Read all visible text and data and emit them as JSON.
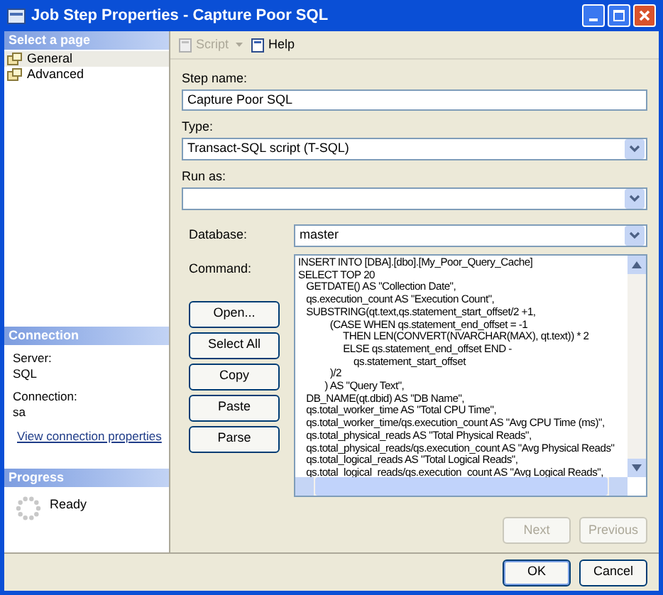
{
  "window": {
    "title": "Job Step Properties - Capture Poor SQL"
  },
  "select_page": {
    "header": "Select a page",
    "items": [
      {
        "label": "General",
        "selected": true
      },
      {
        "label": "Advanced",
        "selected": false
      }
    ]
  },
  "connection": {
    "header": "Connection",
    "server_label": "Server:",
    "server": "SQL",
    "connection_label": "Connection:",
    "connection": "sa",
    "link": "View connection properties"
  },
  "progress": {
    "header": "Progress",
    "status": "Ready"
  },
  "toolbar": [
    {
      "label": "Script",
      "disabled": true,
      "kind": "dropdown"
    },
    {
      "label": "Help",
      "disabled": false,
      "kind": "button"
    }
  ],
  "step_name": {
    "label": "Step name:",
    "value": "Capture Poor SQL"
  },
  "type": {
    "label": "Type:",
    "value": "Transact-SQL script (T-SQL)"
  },
  "run_as": {
    "label": "Run as:"
  },
  "database": {
    "label": "Database:",
    "value": "master"
  },
  "command": {
    "label": "Command:",
    "buttons": [
      "Open...",
      "Select All",
      "Copy",
      "Paste",
      "Parse"
    ],
    "lines": [
      "INSERT INTO [DBA].[dbo].[My_Poor_Query_Cache]",
      "SELECT TOP 20",
      "   GETDATE() AS \"Collection Date\",",
      "   qs.execution_count AS \"Execution Count\",",
      "   SUBSTRING(qt.text,qs.statement_start_offset/2 +1,",
      "            (CASE WHEN qs.statement_end_offset = -1",
      "                 THEN LEN(CONVERT(NVARCHAR(MAX), qt.text)) * 2",
      "                 ELSE qs.statement_end_offset END -",
      "                     qs.statement_start_offset",
      "            )/2",
      "          ) AS \"Query Text\",",
      "   DB_NAME(qt.dbid) AS \"DB Name\",",
      "   qs.total_worker_time AS \"Total CPU Time\",",
      "   qs.total_worker_time/qs.execution_count AS \"Avg CPU Time (ms)\",",
      "   qs.total_physical_reads AS \"Total Physical Reads\",",
      "   qs.total_physical_reads/qs.execution_count AS \"Avg Physical Reads\"",
      "   qs.total_logical_reads AS \"Total Logical Reads\",",
      "   qs.total_logical_reads/qs.execution_count AS \"Avg Logical Reads\","
    ]
  },
  "nav_buttons": [
    {
      "label": "Next",
      "disabled": true
    },
    {
      "label": "Previous",
      "disabled": true
    }
  ],
  "dialog_buttons": [
    {
      "label": "OK",
      "default": true
    },
    {
      "label": "Cancel",
      "default": false
    }
  ]
}
